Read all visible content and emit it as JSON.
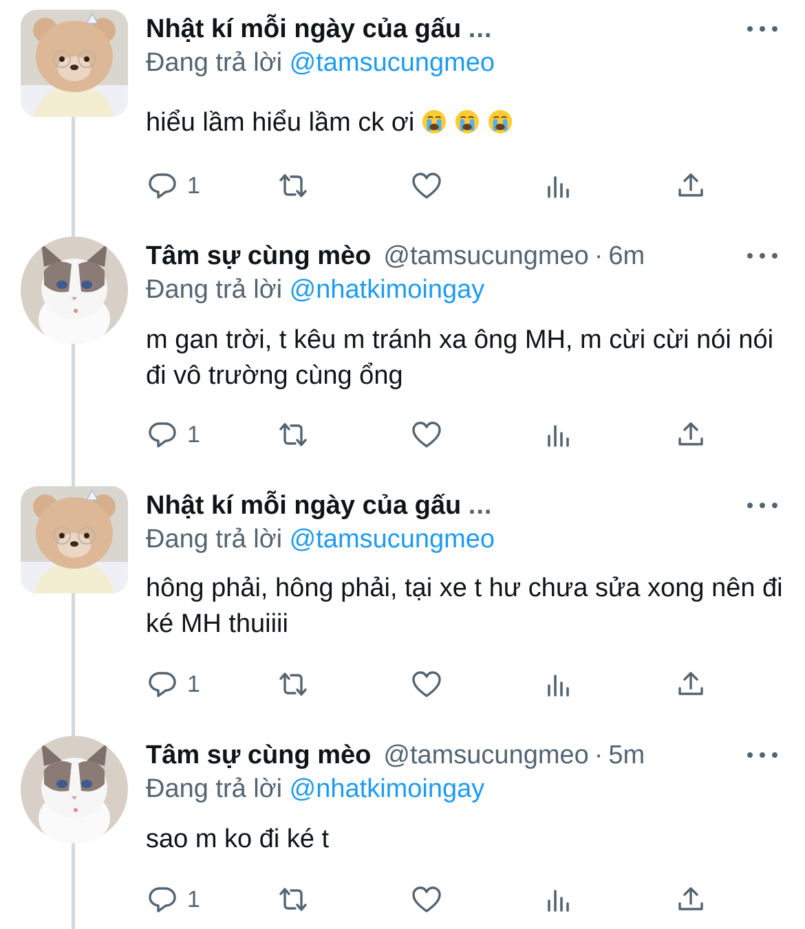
{
  "tweets": [
    {
      "author": "Nhật kí mỗi ngày của gấu",
      "ellipsis": "...",
      "handle": "",
      "time": "",
      "avatar_icon": "bear-avatar",
      "reply_prefix": "Đang trả lời",
      "reply_to": "@tamsucungmeo",
      "body": "hiểu lầm hiểu lầm ck ơi",
      "emoji": [
        "loudly-crying-face",
        "loudly-crying-face",
        "loudly-crying-face"
      ],
      "reply_count": "1"
    },
    {
      "author": "Tâm sự cùng mèo",
      "ellipsis": "",
      "handle": "@tamsucungmeo",
      "separator": "·",
      "time": "6m",
      "avatar_icon": "cat-avatar",
      "reply_prefix": "Đang trả lời",
      "reply_to": "@nhatkimoingay",
      "body": "m gan trời, t kêu m tránh xa ông MH, m cừi cừi nói nói đi vô trường cùng ổng",
      "reply_count": "1"
    },
    {
      "author": "Nhật kí mỗi ngày của gấu",
      "ellipsis": "...",
      "handle": "",
      "time": "",
      "avatar_icon": "bear-avatar",
      "reply_prefix": "Đang trả lời",
      "reply_to": "@tamsucungmeo",
      "body": "hông phải, hông phải, tại xe t hư chưa sửa xong nên đi ké MH thuiiii",
      "reply_count": "1"
    },
    {
      "author": "Tâm sự cùng mèo",
      "ellipsis": "",
      "handle": "@tamsucungmeo",
      "separator": "·",
      "time": "5m",
      "avatar_icon": "cat-avatar",
      "reply_prefix": "Đang trả lời",
      "reply_to": "@nhatkimoingay",
      "body": "sao m ko đi ké t",
      "reply_count": "1"
    }
  ],
  "action_icons": [
    "reply-icon",
    "retweet-icon",
    "like-icon",
    "views-icon",
    "share-icon"
  ],
  "colors": {
    "accent": "#1d9bf0",
    "secondary_text": "#536471",
    "thread_line": "#cfd9de"
  }
}
